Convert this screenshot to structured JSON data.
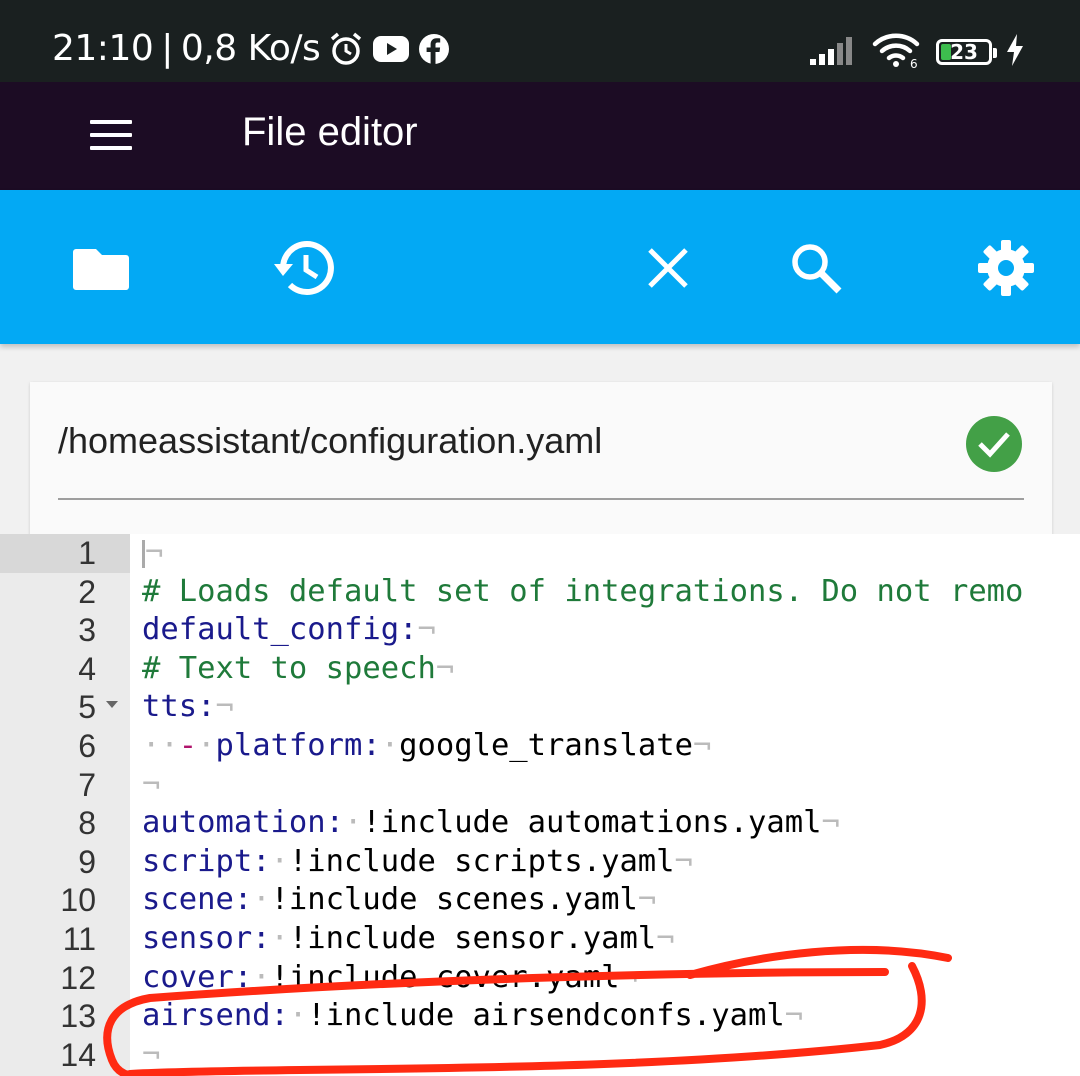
{
  "status_bar": {
    "time": "21:10",
    "separator": "|",
    "speed": "0,8 Ko/s",
    "battery_level": "23",
    "icons": [
      "alarm-icon",
      "youtube-icon",
      "facebook-icon",
      "signal-icon",
      "wifi-icon",
      "battery-icon",
      "charging-icon"
    ]
  },
  "app_bar": {
    "title": "File editor",
    "menu_icon": "hamburger-menu-icon"
  },
  "toolbar": {
    "color": "#03a9f4",
    "buttons": [
      "folder-icon",
      "history-icon",
      "close-icon",
      "search-icon",
      "settings-gear-icon"
    ]
  },
  "file": {
    "path": "/homeassistant/configuration.yaml",
    "status_icon": "check-circle-icon",
    "status_color": "#43a047"
  },
  "editor": {
    "line_numbers": [
      "1",
      "2",
      "3",
      "4",
      "5",
      "6",
      "7",
      "8",
      "9",
      "10",
      "11",
      "12",
      "13",
      "14"
    ],
    "lines": {
      "l2_comment": "# Loads default set of integrations. Do not remo",
      "l3_key": "default_config:",
      "l4_comment": "# Text to speech",
      "l5_key": "tts:",
      "l6_dash": "-",
      "l6_key": "platform:",
      "l6_value": "google_translate",
      "l8_key": "automation:",
      "l8_value": "!include automations.yaml",
      "l9_key": "script:",
      "l9_value": "!include scripts.yaml",
      "l10_key": "scene:",
      "l10_value": "!include scenes.yaml",
      "l11_key": "sensor:",
      "l11_value": "!include sensor.yaml",
      "l12_key": "cover:",
      "l12_value": "!include cover.yaml",
      "l13_key": "airsend:",
      "l13_value": "!include airsendconfs.yaml"
    },
    "eol_marker": "¬",
    "annotation_color": "#ff2a12"
  }
}
